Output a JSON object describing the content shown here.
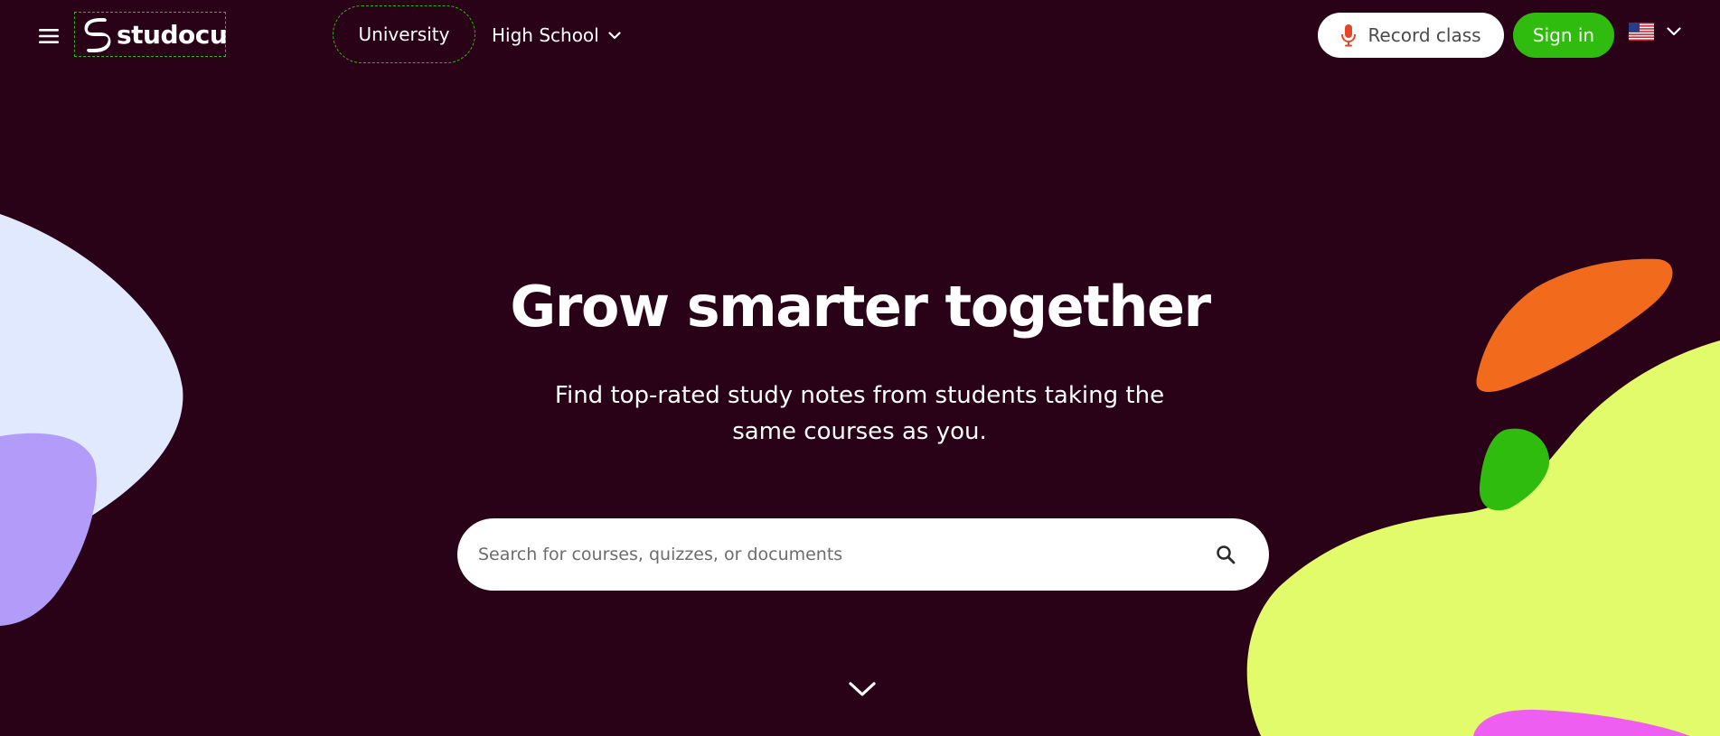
{
  "header": {
    "menu_icon": "hamburger-menu-icon",
    "logo": {
      "text": "studocu",
      "icon": "studocu-logo-icon"
    },
    "nav": {
      "university_label": "University",
      "high_school_label": "High School",
      "high_school_icon": "chevron-down-icon"
    },
    "record_class": {
      "label": "Record class",
      "icon": "microphone-icon"
    },
    "sign_in_label": "Sign in",
    "language": {
      "flag_icon": "us-flag-icon",
      "chevron_icon": "chevron-down-icon"
    }
  },
  "hero": {
    "title": "Grow smarter together",
    "subtitle": "Find top-rated study notes from students taking the same courses as you."
  },
  "search": {
    "placeholder": "Search for courses, quizzes, or documents",
    "value": "",
    "icon": "search-icon"
  },
  "scroll_down_icon": "chevron-down-icon",
  "colors": {
    "background": "#2a0218",
    "brand_green": "#2fbc0e",
    "blob_lavender": "#e0e9fd",
    "blob_purple": "#b39cf9",
    "blob_orange": "#f26b1d",
    "blob_green": "#2fbc0e",
    "blob_lime": "#e2fb6b",
    "blob_pink": "#ee5ef0",
    "mic_red": "#e5462a"
  }
}
